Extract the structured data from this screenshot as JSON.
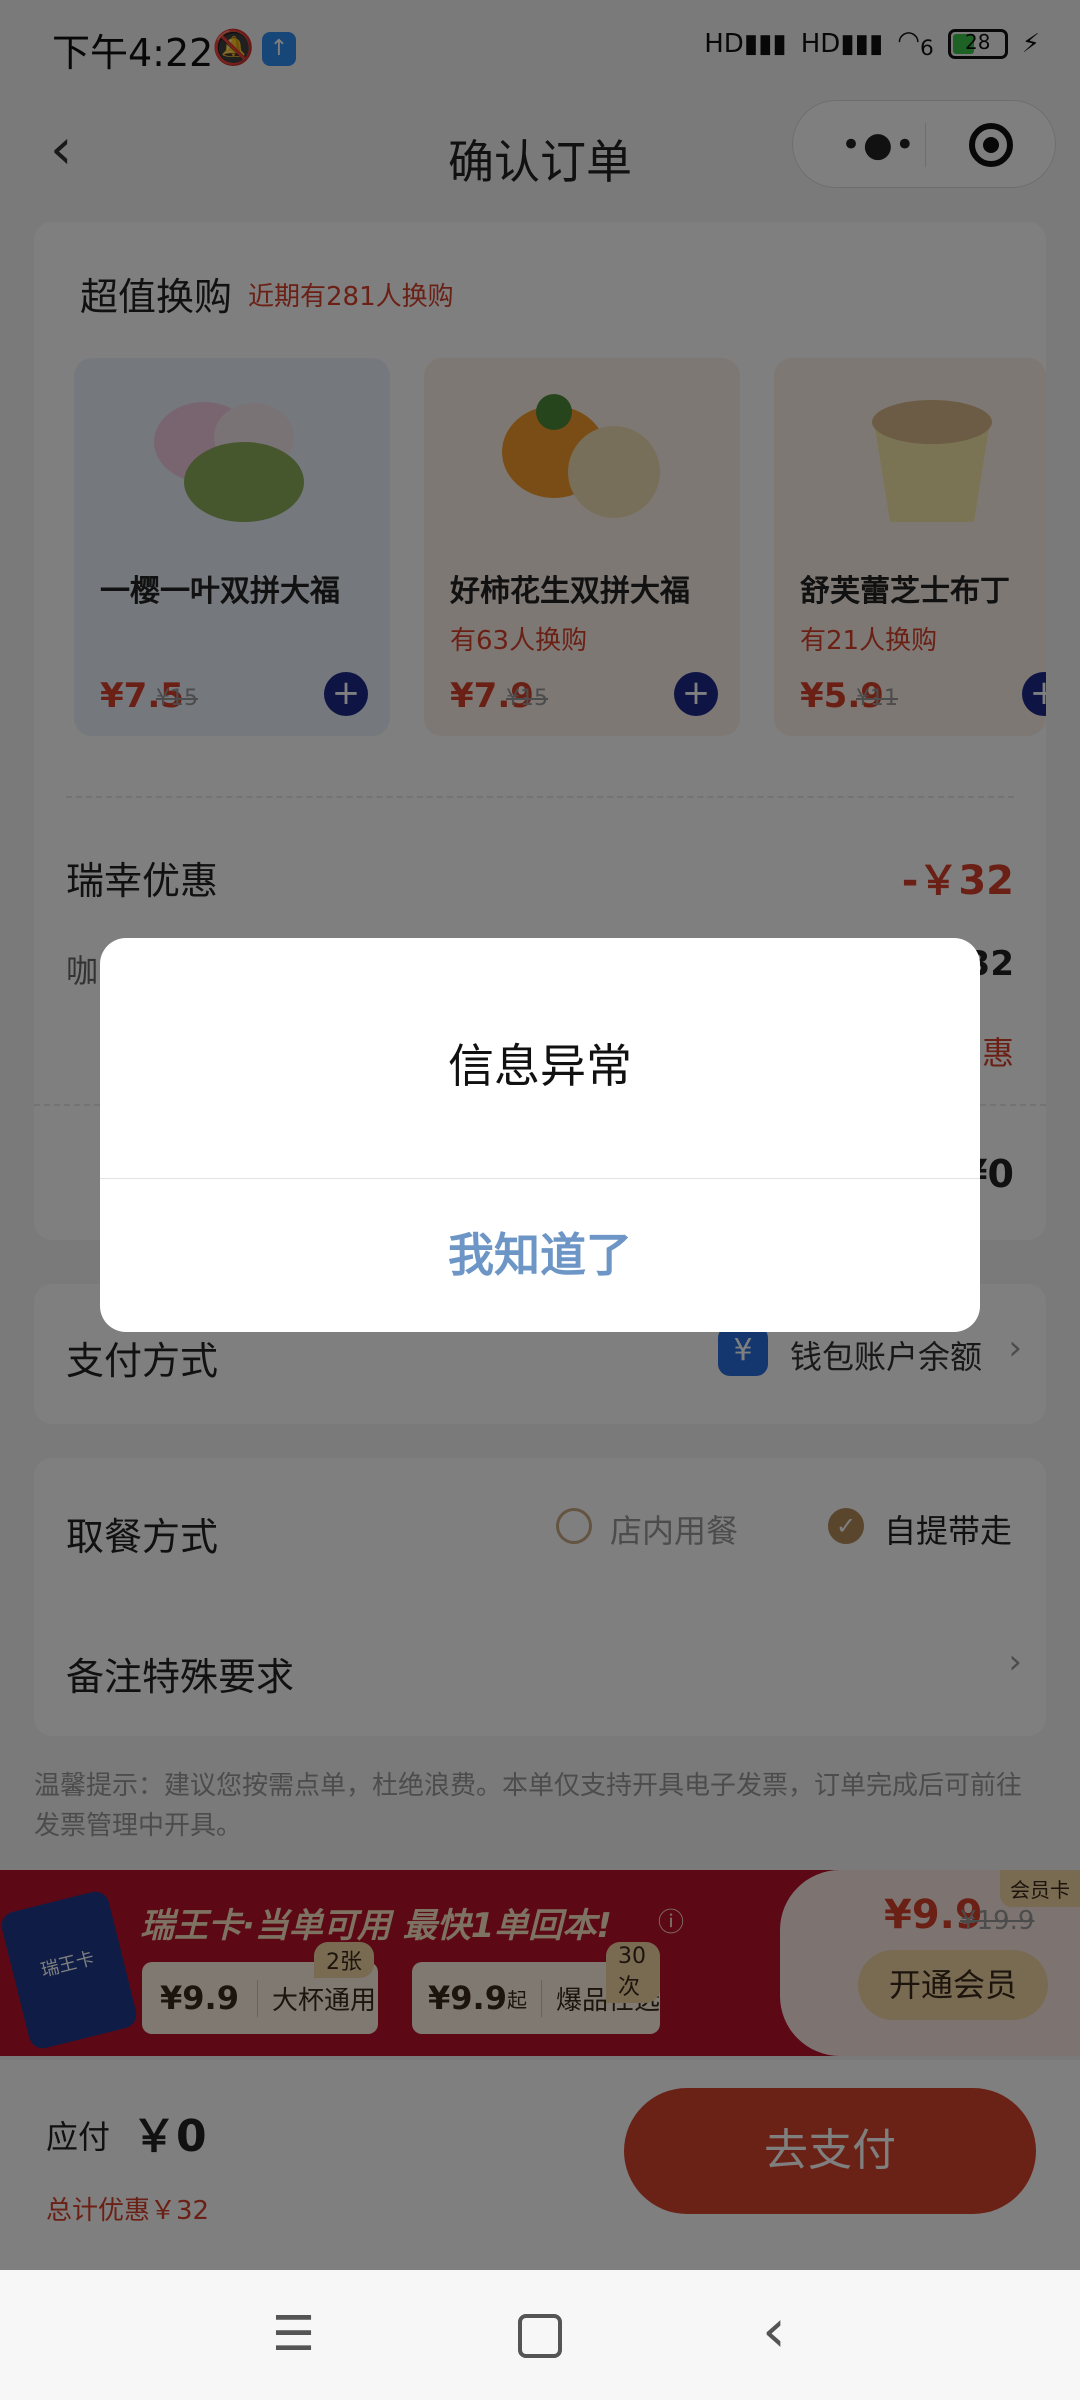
{
  "status_bar": {
    "time": "下午4:22",
    "signal1": "HD",
    "signal2": "HD",
    "wifi": "6",
    "battery": "28"
  },
  "nav": {
    "title": "确认订单"
  },
  "exchange": {
    "title": "超值换购",
    "subtitle": "近期有281人换购",
    "items": [
      {
        "name": "一樱一叶双拼大福",
        "sub": "",
        "price": "¥7.5",
        "orig": "¥15"
      },
      {
        "name": "好柿花生双拼大福",
        "sub": "有63人换购",
        "price": "¥7.9",
        "orig": "¥15"
      },
      {
        "name": "舒芙蕾芝士布丁",
        "sub": "有21人换购",
        "price": "¥5.9",
        "orig": "¥11"
      }
    ]
  },
  "discount": {
    "label": "瑞幸优惠",
    "value": "-￥32",
    "row2_left": "咖",
    "row2_right": "32",
    "row3_right": "惠",
    "row4_right": "¥0"
  },
  "payment": {
    "label": "支付方式",
    "method": "钱包账户余额",
    "icon": "yen-wallet-icon"
  },
  "pickup": {
    "label": "取餐方式",
    "option1": "店内用餐",
    "option2": "自提带走",
    "selected": "自提带走"
  },
  "remark": {
    "label": "备注特殊要求"
  },
  "tip": "温馨提示：建议您按需点单，杜绝浪费。本单仅支持开具电子发票，订单完成后可前往发票管理中开具。",
  "banner": {
    "card_label": "瑞王卡",
    "headline": "瑞王卡·当单可用 最快1单回本!",
    "coupon1_price": "¥9.9",
    "coupon1_text": "大杯通用",
    "coupon1_count": "2张",
    "coupon2_price": "¥9.9",
    "coupon2_suffix": "起",
    "coupon2_text": "爆品任选",
    "coupon2_count": "30次",
    "member_badge": "会员卡",
    "price": "¥9.9",
    "orig": "¥19.9",
    "cta": "开通会员"
  },
  "pay": {
    "label": "应付",
    "amount": "￥0",
    "saved": "总计优惠￥32",
    "button": "去支付"
  },
  "dialog": {
    "message": "信息异常",
    "confirm": "我知道了"
  },
  "colors": {
    "accent_red": "#d6402a",
    "dialog_button": "#6d96c6",
    "banner_red": "#b8112a"
  }
}
